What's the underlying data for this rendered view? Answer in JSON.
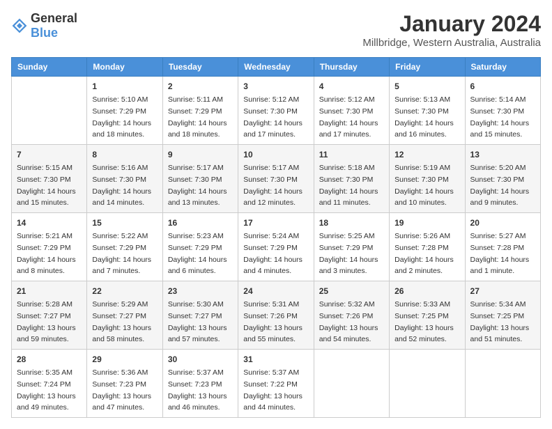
{
  "logo": {
    "general": "General",
    "blue": "Blue"
  },
  "title": "January 2024",
  "location": "Millbridge, Western Australia, Australia",
  "days_header": [
    "Sunday",
    "Monday",
    "Tuesday",
    "Wednesday",
    "Thursday",
    "Friday",
    "Saturday"
  ],
  "weeks": [
    [
      {
        "day": "",
        "info": ""
      },
      {
        "day": "1",
        "info": "Sunrise: 5:10 AM\nSunset: 7:29 PM\nDaylight: 14 hours\nand 18 minutes."
      },
      {
        "day": "2",
        "info": "Sunrise: 5:11 AM\nSunset: 7:29 PM\nDaylight: 14 hours\nand 18 minutes."
      },
      {
        "day": "3",
        "info": "Sunrise: 5:12 AM\nSunset: 7:30 PM\nDaylight: 14 hours\nand 17 minutes."
      },
      {
        "day": "4",
        "info": "Sunrise: 5:12 AM\nSunset: 7:30 PM\nDaylight: 14 hours\nand 17 minutes."
      },
      {
        "day": "5",
        "info": "Sunrise: 5:13 AM\nSunset: 7:30 PM\nDaylight: 14 hours\nand 16 minutes."
      },
      {
        "day": "6",
        "info": "Sunrise: 5:14 AM\nSunset: 7:30 PM\nDaylight: 14 hours\nand 15 minutes."
      }
    ],
    [
      {
        "day": "7",
        "info": "Sunrise: 5:15 AM\nSunset: 7:30 PM\nDaylight: 14 hours\nand 15 minutes."
      },
      {
        "day": "8",
        "info": "Sunrise: 5:16 AM\nSunset: 7:30 PM\nDaylight: 14 hours\nand 14 minutes."
      },
      {
        "day": "9",
        "info": "Sunrise: 5:17 AM\nSunset: 7:30 PM\nDaylight: 14 hours\nand 13 minutes."
      },
      {
        "day": "10",
        "info": "Sunrise: 5:17 AM\nSunset: 7:30 PM\nDaylight: 14 hours\nand 12 minutes."
      },
      {
        "day": "11",
        "info": "Sunrise: 5:18 AM\nSunset: 7:30 PM\nDaylight: 14 hours\nand 11 minutes."
      },
      {
        "day": "12",
        "info": "Sunrise: 5:19 AM\nSunset: 7:30 PM\nDaylight: 14 hours\nand 10 minutes."
      },
      {
        "day": "13",
        "info": "Sunrise: 5:20 AM\nSunset: 7:30 PM\nDaylight: 14 hours\nand 9 minutes."
      }
    ],
    [
      {
        "day": "14",
        "info": "Sunrise: 5:21 AM\nSunset: 7:29 PM\nDaylight: 14 hours\nand 8 minutes."
      },
      {
        "day": "15",
        "info": "Sunrise: 5:22 AM\nSunset: 7:29 PM\nDaylight: 14 hours\nand 7 minutes."
      },
      {
        "day": "16",
        "info": "Sunrise: 5:23 AM\nSunset: 7:29 PM\nDaylight: 14 hours\nand 6 minutes."
      },
      {
        "day": "17",
        "info": "Sunrise: 5:24 AM\nSunset: 7:29 PM\nDaylight: 14 hours\nand 4 minutes."
      },
      {
        "day": "18",
        "info": "Sunrise: 5:25 AM\nSunset: 7:29 PM\nDaylight: 14 hours\nand 3 minutes."
      },
      {
        "day": "19",
        "info": "Sunrise: 5:26 AM\nSunset: 7:28 PM\nDaylight: 14 hours\nand 2 minutes."
      },
      {
        "day": "20",
        "info": "Sunrise: 5:27 AM\nSunset: 7:28 PM\nDaylight: 14 hours\nand 1 minute."
      }
    ],
    [
      {
        "day": "21",
        "info": "Sunrise: 5:28 AM\nSunset: 7:27 PM\nDaylight: 13 hours\nand 59 minutes."
      },
      {
        "day": "22",
        "info": "Sunrise: 5:29 AM\nSunset: 7:27 PM\nDaylight: 13 hours\nand 58 minutes."
      },
      {
        "day": "23",
        "info": "Sunrise: 5:30 AM\nSunset: 7:27 PM\nDaylight: 13 hours\nand 57 minutes."
      },
      {
        "day": "24",
        "info": "Sunrise: 5:31 AM\nSunset: 7:26 PM\nDaylight: 13 hours\nand 55 minutes."
      },
      {
        "day": "25",
        "info": "Sunrise: 5:32 AM\nSunset: 7:26 PM\nDaylight: 13 hours\nand 54 minutes."
      },
      {
        "day": "26",
        "info": "Sunrise: 5:33 AM\nSunset: 7:25 PM\nDaylight: 13 hours\nand 52 minutes."
      },
      {
        "day": "27",
        "info": "Sunrise: 5:34 AM\nSunset: 7:25 PM\nDaylight: 13 hours\nand 51 minutes."
      }
    ],
    [
      {
        "day": "28",
        "info": "Sunrise: 5:35 AM\nSunset: 7:24 PM\nDaylight: 13 hours\nand 49 minutes."
      },
      {
        "day": "29",
        "info": "Sunrise: 5:36 AM\nSunset: 7:23 PM\nDaylight: 13 hours\nand 47 minutes."
      },
      {
        "day": "30",
        "info": "Sunrise: 5:37 AM\nSunset: 7:23 PM\nDaylight: 13 hours\nand 46 minutes."
      },
      {
        "day": "31",
        "info": "Sunrise: 5:37 AM\nSunset: 7:22 PM\nDaylight: 13 hours\nand 44 minutes."
      },
      {
        "day": "",
        "info": ""
      },
      {
        "day": "",
        "info": ""
      },
      {
        "day": "",
        "info": ""
      }
    ]
  ]
}
